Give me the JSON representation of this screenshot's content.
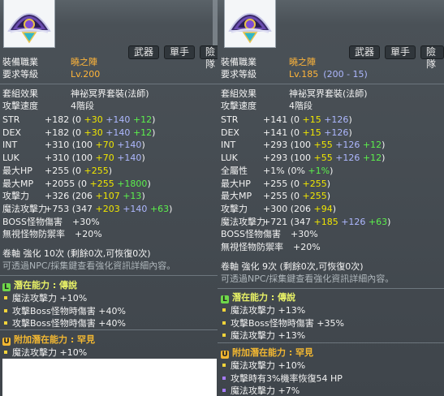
{
  "left": {
    "tags": [
      "武器",
      "單手",
      "險隊"
    ],
    "job_label": "裝備職業",
    "job_value": "曉之陣",
    "level_label": "要求等級",
    "level_value": "Lv.200",
    "set_label": "套組效果",
    "set_value": "神祕冥界套裝(法師)",
    "speed_label": "攻擊速度",
    "speed_value": "4階段",
    "stats": [
      {
        "name": "STR",
        "parts": [
          [
            "+182 (0 ",
            "w"
          ],
          [
            "+30",
            "y"
          ],
          [
            " ",
            "w"
          ],
          [
            "+140",
            "b"
          ],
          [
            " ",
            "w"
          ],
          [
            "+12",
            "g"
          ],
          [
            ")",
            "w"
          ]
        ]
      },
      {
        "name": "DEX",
        "parts": [
          [
            "+182 (0 ",
            "w"
          ],
          [
            "+30",
            "y"
          ],
          [
            " ",
            "w"
          ],
          [
            "+140",
            "b"
          ],
          [
            " ",
            "w"
          ],
          [
            "+12",
            "g"
          ],
          [
            ")",
            "w"
          ]
        ]
      },
      {
        "name": "INT",
        "parts": [
          [
            "+310 (100 ",
            "w"
          ],
          [
            "+70",
            "y"
          ],
          [
            " ",
            "w"
          ],
          [
            "+140",
            "b"
          ],
          [
            ")",
            "w"
          ]
        ]
      },
      {
        "name": "LUK",
        "parts": [
          [
            "+310 (100 ",
            "w"
          ],
          [
            "+70",
            "y"
          ],
          [
            " ",
            "w"
          ],
          [
            "+140",
            "b"
          ],
          [
            ")",
            "w"
          ]
        ]
      },
      {
        "name": "最大HP",
        "parts": [
          [
            "+255 (0 ",
            "w"
          ],
          [
            "+255",
            "y"
          ],
          [
            ")",
            "w"
          ]
        ]
      },
      {
        "name": "最大MP",
        "parts": [
          [
            "+2055 (0 ",
            "w"
          ],
          [
            "+255",
            "y"
          ],
          [
            " ",
            "w"
          ],
          [
            "+1800",
            "g"
          ],
          [
            ")",
            "w"
          ]
        ]
      },
      {
        "name": "攻擊力",
        "parts": [
          [
            "+326 (206 ",
            "w"
          ],
          [
            "+107",
            "y"
          ],
          [
            " ",
            "w"
          ],
          [
            "+13",
            "g"
          ],
          [
            ")",
            "w"
          ]
        ]
      },
      {
        "name": "魔法攻擊力",
        "parts": [
          [
            "+753 (347 ",
            "w"
          ],
          [
            "+203",
            "y"
          ],
          [
            " ",
            "w"
          ],
          [
            "+140",
            "b"
          ],
          [
            " ",
            "w"
          ],
          [
            "+63",
            "g"
          ],
          [
            ")",
            "w"
          ]
        ]
      },
      {
        "name": "BOSS怪物傷害",
        "parts": [
          [
            "+30%",
            "w"
          ]
        ]
      },
      {
        "name": "無視怪物防禦率",
        "parts": [
          [
            "+20%",
            "w"
          ]
        ]
      }
    ],
    "scroll_line": "卷軸 強化 10次 (剩餘0次,可恢復0次)",
    "hint_line": "可透過NPC/採集鍵查看強化資訊詳細內容。",
    "potential_title": "潛在能力 : 傳說",
    "potential_lines": [
      "魔法攻擊力 +10%",
      "攻擊Boss怪物時傷害 +40%",
      "攻擊Boss怪物時傷害 +40%"
    ],
    "bonus_title": "附加潛在能力 : 罕見",
    "bonus_lines": [
      "魔法攻擊力 +10%"
    ]
  },
  "right": {
    "tags": [
      "武器",
      "單手",
      "險隊"
    ],
    "job_label": "裝備職業",
    "job_value": "曉之陣",
    "level_label": "要求等級",
    "level_value": "Lv.185",
    "level_extra": "(200 - 15)",
    "set_label": "套組效果",
    "set_value": "神祕冥界套裝(法師)",
    "speed_label": "攻擊速度",
    "speed_value": "4階段",
    "stats": [
      {
        "name": "STR",
        "parts": [
          [
            "+141 (0 ",
            "w"
          ],
          [
            "+15",
            "y"
          ],
          [
            " ",
            "w"
          ],
          [
            "+126",
            "b"
          ],
          [
            ")",
            "w"
          ]
        ]
      },
      {
        "name": "DEX",
        "parts": [
          [
            "+141 (0 ",
            "w"
          ],
          [
            "+15",
            "y"
          ],
          [
            " ",
            "w"
          ],
          [
            "+126",
            "b"
          ],
          [
            ")",
            "w"
          ]
        ]
      },
      {
        "name": "INT",
        "parts": [
          [
            "+293 (100 ",
            "w"
          ],
          [
            "+55",
            "y"
          ],
          [
            " ",
            "w"
          ],
          [
            "+126",
            "b"
          ],
          [
            " ",
            "w"
          ],
          [
            "+12",
            "g"
          ],
          [
            ")",
            "w"
          ]
        ]
      },
      {
        "name": "LUK",
        "parts": [
          [
            "+293 (100 ",
            "w"
          ],
          [
            "+55",
            "y"
          ],
          [
            " ",
            "w"
          ],
          [
            "+126",
            "b"
          ],
          [
            " ",
            "w"
          ],
          [
            "+12",
            "g"
          ],
          [
            ")",
            "w"
          ]
        ]
      },
      {
        "name": "全屬性",
        "parts": [
          [
            "+1% (0% ",
            "w"
          ],
          [
            "+1%",
            "g"
          ],
          [
            ")",
            "w"
          ]
        ]
      },
      {
        "name": "最大HP",
        "parts": [
          [
            "+255 (0 ",
            "w"
          ],
          [
            "+255",
            "y"
          ],
          [
            ")",
            "w"
          ]
        ]
      },
      {
        "name": "最大MP",
        "parts": [
          [
            "+255 (0 ",
            "w"
          ],
          [
            "+255",
            "y"
          ],
          [
            ")",
            "w"
          ]
        ]
      },
      {
        "name": "攻擊力",
        "parts": [
          [
            "+300 (206 ",
            "w"
          ],
          [
            "+94",
            "y"
          ],
          [
            ")",
            "w"
          ]
        ]
      },
      {
        "name": "魔法攻擊力",
        "parts": [
          [
            "+721 (347 ",
            "w"
          ],
          [
            "+185",
            "y"
          ],
          [
            " ",
            "w"
          ],
          [
            "+126",
            "b"
          ],
          [
            " ",
            "w"
          ],
          [
            "+63",
            "g"
          ],
          [
            ")",
            "w"
          ]
        ]
      },
      {
        "name": "BOSS怪物傷害",
        "parts": [
          [
            "+30%",
            "w"
          ]
        ]
      },
      {
        "name": "無視怪物防禦率",
        "parts": [
          [
            "+20%",
            "w"
          ]
        ]
      }
    ],
    "scroll_line": "卷軸 強化 9次 (剩餘0次,可恢復0次)",
    "hint_line": "可透過NPC/採集鍵查看強化資訊詳細內容。",
    "potential_title": "潛在能力 : 傳說",
    "potential_lines": [
      "魔法攻擊力 +13%",
      "攻擊Boss怪物時傷害 +35%",
      "魔法攻擊力 +13%"
    ],
    "bonus_title": "附加潛在能力 : 罕見",
    "bonus_lines": [
      "魔法攻擊力 +10%",
      "攻擊時有3%機率恢復54 HP",
      "魔法攻擊力 +7%"
    ]
  },
  "colors": {
    "legendary": "#6fd84a",
    "unique_bonus": "#f2b731",
    "bonus_bullet_purple": "#a77cff",
    "bonus_bullet_yellow": "#f2d43a"
  }
}
